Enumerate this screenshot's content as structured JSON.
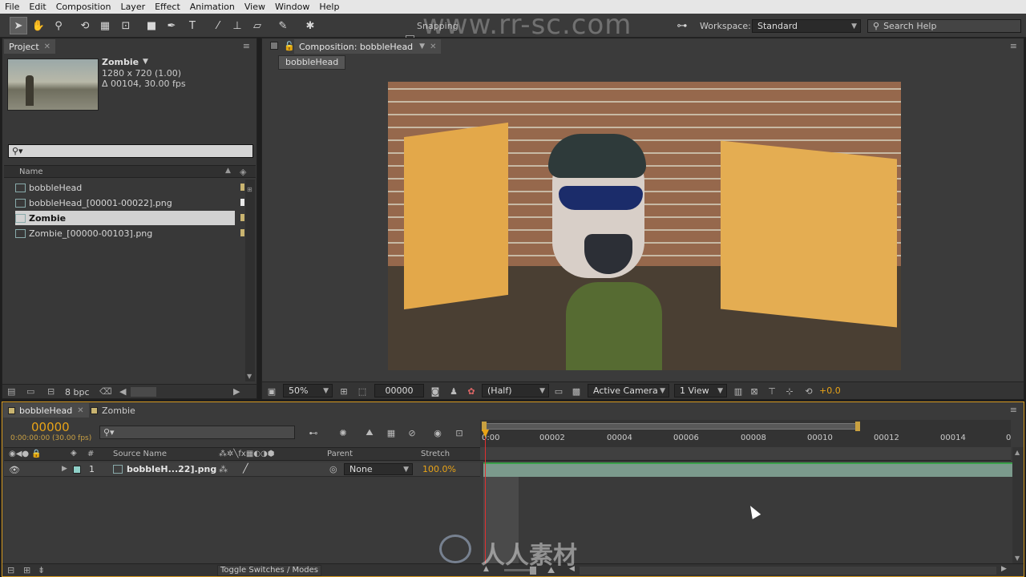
{
  "menu": [
    "File",
    "Edit",
    "Composition",
    "Layer",
    "Effect",
    "Animation",
    "View",
    "Window",
    "Help"
  ],
  "toolbar": {
    "snapping_label": "Snapping",
    "workspace_label": "Workspace:",
    "workspace_value": "Standard",
    "search_placeholder": "Search Help"
  },
  "project": {
    "tab": "Project",
    "item_name": "Zombie",
    "item_dims": "1280 x 720 (1.00)",
    "item_duration": "Δ 00104, 30.00 fps",
    "name_header": "Name",
    "items": [
      {
        "name": "bobbleHead",
        "type": "comp",
        "swatch": "#c9b470"
      },
      {
        "name": "bobbleHead_[00001-00022].png",
        "type": "footage",
        "swatch": "#e8e8e8"
      },
      {
        "name": "Zombie",
        "type": "comp",
        "swatch": "#c9b470",
        "selected": true
      },
      {
        "name": "Zombie_[00000-00103].png",
        "type": "footage",
        "swatch": "#c9b470"
      }
    ],
    "bpc": "8 bpc"
  },
  "composition": {
    "tab": "Composition: bobbleHead",
    "breadcrumb": "bobbleHead",
    "zoom": "50%",
    "timecode": "00000",
    "resolution": "(Half)",
    "camera": "Active Camera",
    "views": "1 View",
    "exposure": "+0.0"
  },
  "timeline": {
    "tabs": [
      "bobbleHead",
      "Zombie"
    ],
    "current_time": "00000",
    "current_time_sub": "0:00:00:00 (30.00 fps)",
    "headers": {
      "source": "Source Name",
      "parent": "Parent",
      "stretch": "Stretch",
      "num": "#"
    },
    "layer": {
      "num": "1",
      "name": "bobbleH...22].png",
      "parent": "None",
      "stretch": "100.0%"
    },
    "ruler": [
      "00002",
      "00004",
      "00006",
      "00008",
      "00010",
      "00012",
      "00014",
      "0"
    ],
    "ruler_start": "0:00",
    "toggle_label": "Toggle Switches / Modes"
  },
  "watermark": {
    "url": "www.rr-sc.com",
    "cn": "人人素材"
  },
  "colors": {
    "accent": "#e8a317",
    "layer_bar": "#7b9a8c",
    "playhead": "#e03030"
  }
}
